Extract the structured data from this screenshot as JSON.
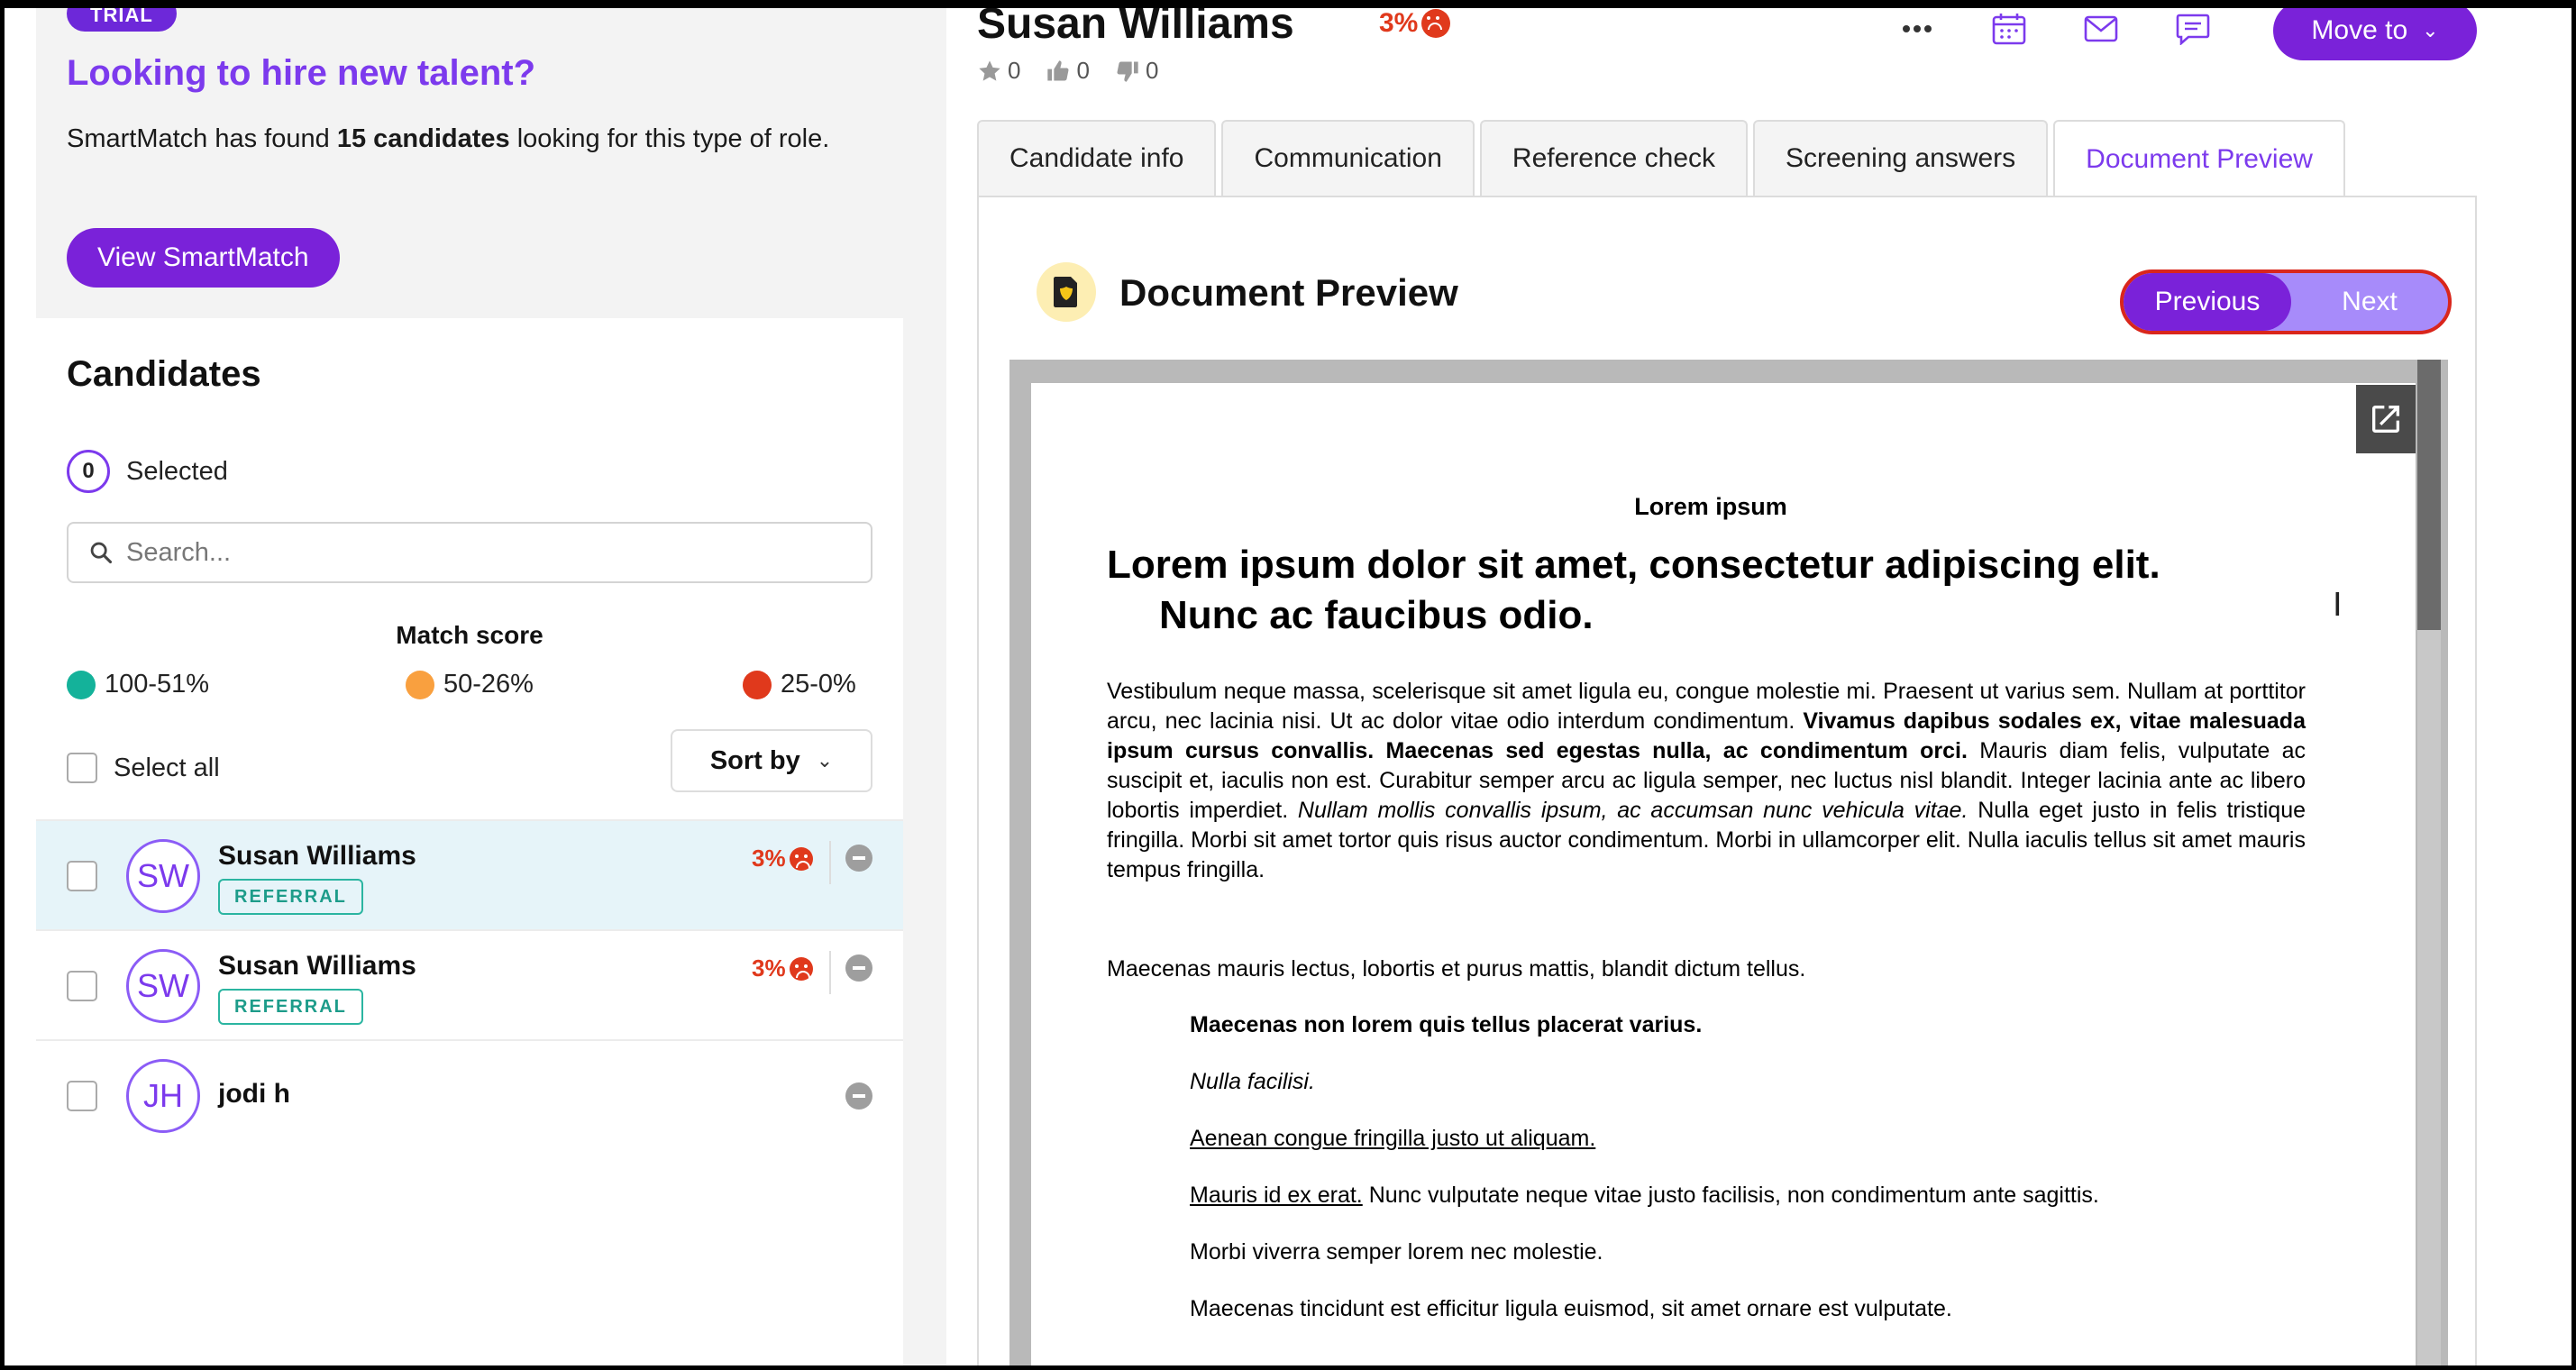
{
  "promo": {
    "badge": "TRIAL",
    "title": "Looking to hire new talent?",
    "text_pre": "SmartMatch has found ",
    "text_bold": "15 candidates",
    "text_post": " looking for this type of role.",
    "button": "View SmartMatch"
  },
  "candidates": {
    "title": "Candidates",
    "selected_count": "0",
    "selected_label": "Selected",
    "search_placeholder": "Search...",
    "match_score_title": "Match score",
    "legend": [
      {
        "label": "100-51%",
        "color": "#14b29a"
      },
      {
        "label": "50-26%",
        "color": "#f9a03f"
      },
      {
        "label": "25-0%",
        "color": "#e0391c"
      }
    ],
    "select_all": "Select all",
    "sort_by": "Sort by",
    "list": [
      {
        "initials": "SW",
        "name": "Susan Williams",
        "tag": "REFERRAL",
        "score": "3%",
        "active": true
      },
      {
        "initials": "SW",
        "name": "Susan Williams",
        "tag": "REFERRAL",
        "score": "3%",
        "active": false
      },
      {
        "initials": "JH",
        "name": "jodi h",
        "tag": "",
        "score": "",
        "active": false
      }
    ]
  },
  "header": {
    "name": "Susan Williams",
    "score": "3%",
    "stars": "0",
    "likes": "0",
    "dislikes": "0",
    "move_to": "Move to"
  },
  "tabs": [
    "Candidate info",
    "Communication",
    "Reference check",
    "Screening answers",
    "Document Preview"
  ],
  "active_tab": "Document Preview",
  "preview": {
    "title": "Document Preview",
    "prev": "Previous",
    "next": "Next"
  },
  "document": {
    "header": "Lorem ipsum",
    "h1_line1": "Lorem ipsum dolor sit amet, consectetur adipiscing elit.",
    "h1_line2": "Nunc ac faucibus odio.",
    "p1_a": "Vestibulum neque massa, scelerisque sit amet ligula eu, congue molestie mi. Praesent ut varius sem. Nullam at porttitor arcu, nec lacinia nisi. Ut ac dolor vitae odio interdum condimentum. ",
    "p1_b": "Vivamus dapibus sodales ex, vitae malesuada ipsum cursus convallis. Maecenas sed egestas nulla, ac condimentum orci.",
    "p1_c": " Mauris diam felis, vulputate ac suscipit et, iaculis non est. Curabitur semper arcu ac ligula semper, nec luctus nisl blandit. Integer lacinia ante ac libero lobortis imperdiet. ",
    "p1_d": "Nullam mollis convallis ipsum, ac accumsan nunc vehicula vitae.",
    "p1_e": " Nulla eget justo in felis tristique fringilla. Morbi sit amet tortor quis risus auctor condimentum. Morbi in ullamcorper elit. Nulla iaculis tellus sit amet mauris tempus fringilla.",
    "p2": "Maecenas mauris lectus, lobortis et purus mattis, blandit dictum tellus.",
    "i1": "Maecenas non lorem quis tellus placerat varius.",
    "i2": "Nulla facilisi.",
    "i3": "Aenean congue fringilla justo ut aliquam.",
    "i4_u": "Mauris id ex erat.",
    "i4_rest": " Nunc vulputate neque vitae justo facilisis, non condimentum ante sagittis.",
    "i5": "Morbi viverra semper lorem nec molestie.",
    "i6": "Maecenas tincidunt est efficitur ligula euismod, sit amet ornare est vulputate."
  }
}
